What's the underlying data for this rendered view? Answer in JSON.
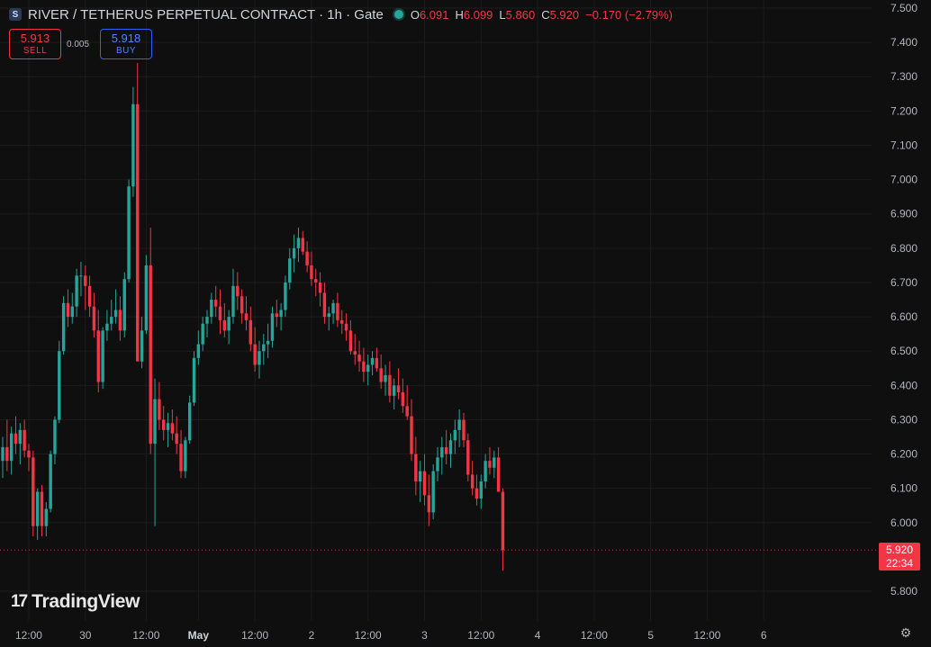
{
  "header": {
    "symbol_icon": "S",
    "title": "RIVER / TETHERUS PERPETUAL CONTRACT · 1h · Gate",
    "ohlc": [
      {
        "k": "O",
        "v": "6.091"
      },
      {
        "k": "H",
        "v": "6.099"
      },
      {
        "k": "L",
        "v": "5.860"
      },
      {
        "k": "C",
        "v": "5.920"
      },
      {
        "k": "",
        "v": "−0.170 (−2.79%)"
      }
    ]
  },
  "trade": {
    "sell_price": "5.913",
    "sell_label": "SELL",
    "spread": "0.005",
    "buy_price": "5.918",
    "buy_label": "BUY"
  },
  "price_tag": {
    "price": "5.920",
    "countdown": "22:34"
  },
  "logo": {
    "mark": "17",
    "text": "TradingView"
  },
  "colors": {
    "up": "#26a69a",
    "down": "#f23645",
    "background": "#0f0f0f",
    "grid": "#1c1c1c"
  },
  "icons": {
    "settings": "gear-icon"
  },
  "chart_data": {
    "type": "candlestick",
    "y_axis": {
      "range": [
        5.72,
        7.5
      ],
      "ticks": [
        "7.500",
        "7.400",
        "7.300",
        "7.200",
        "7.100",
        "7.000",
        "6.900",
        "6.800",
        "6.700",
        "6.600",
        "6.500",
        "6.400",
        "6.300",
        "6.200",
        "6.100",
        "6.000",
        "5.800"
      ]
    },
    "x_axis": {
      "ticks": [
        {
          "label": "12:00",
          "i": 6,
          "major": false
        },
        {
          "label": "30",
          "i": 19,
          "major": false
        },
        {
          "label": "12:00",
          "i": 33,
          "major": false
        },
        {
          "label": "May",
          "i": 45,
          "major": true
        },
        {
          "label": "12:00",
          "i": 58,
          "major": false
        },
        {
          "label": "2",
          "i": 71,
          "major": false
        },
        {
          "label": "12:00",
          "i": 84,
          "major": false
        },
        {
          "label": "3",
          "i": 97,
          "major": false
        },
        {
          "label": "12:00",
          "i": 110,
          "major": false
        },
        {
          "label": "4",
          "i": 123,
          "major": false
        },
        {
          "label": "12:00",
          "i": 136,
          "major": false
        },
        {
          "label": "5",
          "i": 149,
          "major": false
        },
        {
          "label": "12:00",
          "i": 162,
          "major": false
        },
        {
          "label": "6",
          "i": 175,
          "major": false
        }
      ]
    },
    "last_price": 5.92,
    "candles": [
      [
        6.18,
        6.25,
        6.13,
        6.22
      ],
      [
        6.22,
        6.3,
        6.15,
        6.18
      ],
      [
        6.18,
        6.28,
        6.14,
        6.26
      ],
      [
        6.26,
        6.31,
        6.2,
        6.23
      ],
      [
        6.23,
        6.29,
        6.17,
        6.27
      ],
      [
        6.27,
        6.3,
        6.19,
        6.21
      ],
      [
        6.21,
        6.23,
        6.15,
        6.19
      ],
      [
        6.19,
        6.21,
        5.96,
        5.99
      ],
      [
        5.99,
        6.1,
        5.95,
        6.09
      ],
      [
        6.09,
        6.11,
        5.96,
        5.99
      ],
      [
        5.99,
        6.06,
        5.96,
        6.04
      ],
      [
        6.04,
        6.21,
        6.03,
        6.2
      ],
      [
        6.2,
        6.31,
        6.17,
        6.3
      ],
      [
        6.3,
        6.53,
        6.29,
        6.5
      ],
      [
        6.5,
        6.66,
        6.49,
        6.64
      ],
      [
        6.64,
        6.68,
        6.57,
        6.6
      ],
      [
        6.6,
        6.67,
        6.58,
        6.63
      ],
      [
        6.63,
        6.74,
        6.6,
        6.72
      ],
      [
        6.72,
        6.76,
        6.66,
        6.72
      ],
      [
        6.72,
        6.75,
        6.62,
        6.69
      ],
      [
        6.69,
        6.72,
        6.6,
        6.63
      ],
      [
        6.63,
        6.67,
        6.54,
        6.56
      ],
      [
        6.56,
        6.62,
        6.38,
        6.41
      ],
      [
        6.41,
        6.57,
        6.39,
        6.56
      ],
      [
        6.56,
        6.62,
        6.53,
        6.58
      ],
      [
        6.58,
        6.65,
        6.56,
        6.6
      ],
      [
        6.6,
        6.68,
        6.58,
        6.62
      ],
      [
        6.62,
        6.66,
        6.53,
        6.56
      ],
      [
        6.56,
        6.73,
        6.54,
        6.71
      ],
      [
        6.71,
        7.0,
        6.7,
        6.98
      ],
      [
        6.98,
        7.27,
        6.95,
        7.22
      ],
      [
        7.22,
        7.34,
        6.52,
        6.47
      ],
      [
        6.47,
        6.6,
        6.45,
        6.56
      ],
      [
        6.56,
        6.78,
        6.55,
        6.75
      ],
      [
        6.75,
        6.86,
        6.2,
        6.23
      ],
      [
        6.23,
        6.42,
        5.99,
        6.36
      ],
      [
        6.36,
        6.41,
        6.27,
        6.3
      ],
      [
        6.3,
        6.34,
        6.24,
        6.27
      ],
      [
        6.27,
        6.32,
        6.22,
        6.29
      ],
      [
        6.29,
        6.33,
        6.24,
        6.26
      ],
      [
        6.26,
        6.31,
        6.2,
        6.23
      ],
      [
        6.23,
        6.27,
        6.13,
        6.15
      ],
      [
        6.15,
        6.25,
        6.13,
        6.24
      ],
      [
        6.24,
        6.37,
        6.23,
        6.35
      ],
      [
        6.35,
        6.5,
        6.34,
        6.48
      ],
      [
        6.48,
        6.56,
        6.46,
        6.52
      ],
      [
        6.52,
        6.6,
        6.5,
        6.58
      ],
      [
        6.58,
        6.62,
        6.54,
        6.6
      ],
      [
        6.6,
        6.67,
        6.58,
        6.65
      ],
      [
        6.65,
        6.69,
        6.6,
        6.63
      ],
      [
        6.63,
        6.68,
        6.55,
        6.59
      ],
      [
        6.59,
        6.64,
        6.54,
        6.56
      ],
      [
        6.56,
        6.62,
        6.52,
        6.6
      ],
      [
        6.6,
        6.74,
        6.58,
        6.69
      ],
      [
        6.69,
        6.73,
        6.62,
        6.66
      ],
      [
        6.66,
        6.68,
        6.58,
        6.61
      ],
      [
        6.61,
        6.66,
        6.56,
        6.59
      ],
      [
        6.59,
        6.63,
        6.5,
        6.52
      ],
      [
        6.52,
        6.57,
        6.44,
        6.46
      ],
      [
        6.46,
        6.53,
        6.42,
        6.5
      ],
      [
        6.5,
        6.55,
        6.46,
        6.52
      ],
      [
        6.52,
        6.58,
        6.48,
        6.53
      ],
      [
        6.53,
        6.63,
        6.51,
        6.61
      ],
      [
        6.61,
        6.65,
        6.57,
        6.6
      ],
      [
        6.6,
        6.64,
        6.56,
        6.62
      ],
      [
        6.62,
        6.72,
        6.6,
        6.7
      ],
      [
        6.7,
        6.8,
        6.68,
        6.77
      ],
      [
        6.77,
        6.84,
        6.73,
        6.8
      ],
      [
        6.8,
        6.86,
        6.76,
        6.83
      ],
      [
        6.83,
        6.85,
        6.78,
        6.79
      ],
      [
        6.79,
        6.82,
        6.73,
        6.75
      ],
      [
        6.75,
        6.79,
        6.69,
        6.71
      ],
      [
        6.71,
        6.74,
        6.66,
        6.7
      ],
      [
        6.7,
        6.73,
        6.63,
        6.67
      ],
      [
        6.67,
        6.7,
        6.58,
        6.6
      ],
      [
        6.6,
        6.63,
        6.56,
        6.61
      ],
      [
        6.61,
        6.65,
        6.58,
        6.64
      ],
      [
        6.64,
        6.67,
        6.57,
        6.59
      ],
      [
        6.59,
        6.62,
        6.55,
        6.58
      ],
      [
        6.58,
        6.61,
        6.53,
        6.56
      ],
      [
        6.56,
        6.59,
        6.49,
        6.5
      ],
      [
        6.5,
        6.55,
        6.46,
        6.49
      ],
      [
        6.49,
        6.53,
        6.44,
        6.47
      ],
      [
        6.47,
        6.51,
        6.41,
        6.44
      ],
      [
        6.44,
        6.49,
        6.4,
        6.46
      ],
      [
        6.46,
        6.5,
        6.43,
        6.48
      ],
      [
        6.48,
        6.51,
        6.44,
        6.45
      ],
      [
        6.45,
        6.49,
        6.39,
        6.41
      ],
      [
        6.41,
        6.46,
        6.37,
        6.43
      ],
      [
        6.43,
        6.47,
        6.35,
        6.37
      ],
      [
        6.37,
        6.42,
        6.33,
        6.4
      ],
      [
        6.4,
        6.45,
        6.36,
        6.38
      ],
      [
        6.38,
        6.42,
        6.32,
        6.34
      ],
      [
        6.34,
        6.4,
        6.3,
        6.31
      ],
      [
        6.31,
        6.36,
        6.18,
        6.2
      ],
      [
        6.2,
        6.25,
        6.08,
        6.12
      ],
      [
        6.12,
        6.18,
        6.06,
        6.15
      ],
      [
        6.15,
        6.2,
        6.05,
        6.08
      ],
      [
        6.08,
        6.14,
        5.99,
        6.03
      ],
      [
        6.03,
        6.17,
        6.01,
        6.15
      ],
      [
        6.15,
        6.22,
        6.12,
        6.19
      ],
      [
        6.19,
        6.25,
        6.14,
        6.22
      ],
      [
        6.22,
        6.27,
        6.17,
        6.2
      ],
      [
        6.2,
        6.26,
        6.16,
        6.24
      ],
      [
        6.24,
        6.3,
        6.2,
        6.27
      ],
      [
        6.27,
        6.33,
        6.22,
        6.3
      ],
      [
        6.3,
        6.32,
        6.22,
        6.24
      ],
      [
        6.24,
        6.26,
        6.12,
        6.14
      ],
      [
        6.14,
        6.18,
        6.08,
        6.1
      ],
      [
        6.1,
        6.14,
        6.05,
        6.07
      ],
      [
        6.07,
        6.14,
        6.04,
        6.12
      ],
      [
        6.12,
        6.2,
        6.1,
        6.18
      ],
      [
        6.18,
        6.22,
        6.14,
        6.16
      ],
      [
        6.16,
        6.21,
        6.13,
        6.19
      ],
      [
        6.19,
        6.22,
        6.11,
        6.09
      ],
      [
        6.09,
        6.1,
        5.86,
        5.92
      ]
    ]
  }
}
